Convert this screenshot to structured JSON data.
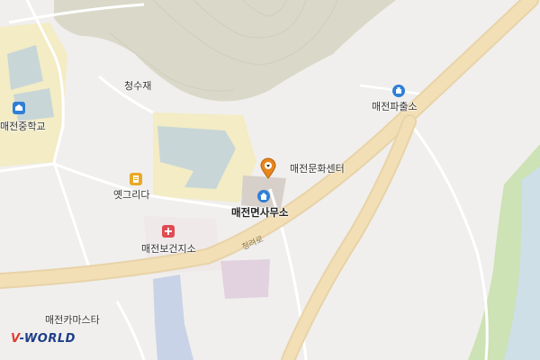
{
  "map": {
    "labels": {
      "cheongsujae": "청수재",
      "middle_school": "매전중학교",
      "police_box": "매전파출소",
      "culture_center": "매전문화센터",
      "township_office": "매전면사무소",
      "yetgeurida": "옛그리다",
      "health_center": "매전보건지소",
      "karaoke": "매전카마스타",
      "road_name": "청려로"
    },
    "logo": {
      "v": "V",
      "rest": "-WORLD"
    }
  }
}
